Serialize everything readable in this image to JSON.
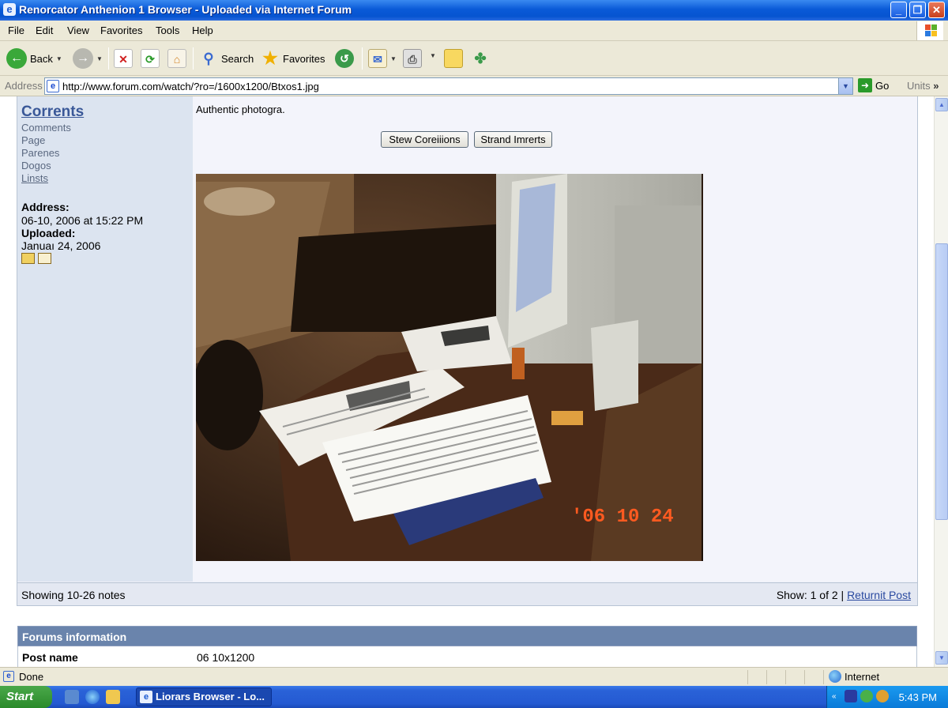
{
  "window": {
    "title": "Renorcator Anthenion 1 Browser - Uploaded via Internet Forum"
  },
  "menu": [
    "File",
    "Edit",
    "View",
    "Favorites",
    "Tools",
    "Help"
  ],
  "toolbar": {
    "back": "Back",
    "search": "Search",
    "favorites": "Favorites"
  },
  "address": {
    "label": "Address",
    "url": "http://www.forum.com/watch/?ro=/1600x1200/Btxos1.jpg",
    "go": "Go",
    "units": "Units"
  },
  "sidebar": {
    "title": "Corrents",
    "links": [
      "Comments",
      "Page",
      "Parenes",
      "Dogos",
      "Linsts"
    ],
    "address_label": "Address:",
    "address_value": "06-10, 2006 at 15:22 PM",
    "uploaded_label": "Uploaded:",
    "uploaded_value": "Januaı 24, 2006"
  },
  "main": {
    "intro": "Authentic photogra.",
    "buttons": [
      "Stew Coreiiions",
      "Strand Imrerts"
    ],
    "photo_timestamp": "'06 10 24"
  },
  "footer": {
    "showing": "Showing 10-26 notes",
    "show_label": "Show: 1 of 2 |",
    "return_link": "Returnit Post"
  },
  "forum_info": {
    "heading": "Forums information",
    "post_name_label": "Post name",
    "post_name_value": "06 10x1200"
  },
  "status": {
    "text": "Done",
    "zone": "Internet"
  },
  "taskbar": {
    "start": "Start",
    "task": "Liorars Browser - Lo...",
    "clock": "5:43 PM"
  }
}
